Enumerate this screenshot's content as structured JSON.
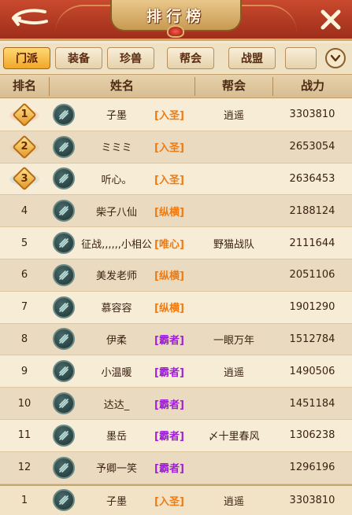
{
  "header": {
    "title": "排行榜",
    "back_icon": "back-arrow-icon",
    "close_icon": "close-icon"
  },
  "tabs": [
    {
      "label": "门派",
      "active": true
    },
    {
      "label": "装备",
      "active": false
    },
    {
      "label": "珍兽",
      "active": false
    },
    {
      "label": "帮会",
      "active": false
    },
    {
      "label": "战盟",
      "active": false
    }
  ],
  "columns": {
    "rank": "排名",
    "name": "姓名",
    "guild": "帮会",
    "power": "战力"
  },
  "rows": [
    {
      "rank": "1",
      "name": "子墨",
      "faction": "[入圣]",
      "guild": "逍遥",
      "power": "3303810"
    },
    {
      "rank": "2",
      "name": "ミミミ",
      "faction": "[入圣]",
      "guild": "",
      "power": "2653054"
    },
    {
      "rank": "3",
      "name": "听心。",
      "faction": "[入圣]",
      "guild": "",
      "power": "2636453"
    },
    {
      "rank": "4",
      "name": "柴子八仙",
      "faction": "[纵横]",
      "guild": "",
      "power": "2188124"
    },
    {
      "rank": "5",
      "name": "征战,,,,,,小相公",
      "faction": "[唯心]",
      "guild": "野猫战队",
      "power": "2111644"
    },
    {
      "rank": "6",
      "name": "美发老师",
      "faction": "[纵横]",
      "guild": "",
      "power": "2051106"
    },
    {
      "rank": "7",
      "name": "慕容容",
      "faction": "[纵横]",
      "guild": "",
      "power": "1901290"
    },
    {
      "rank": "8",
      "name": "伊柔",
      "faction": "[霸者]",
      "guild": "一眼万年",
      "power": "1512784"
    },
    {
      "rank": "9",
      "name": "小温暖",
      "faction": "[霸者]",
      "guild": "逍遥",
      "power": "1490506"
    },
    {
      "rank": "10",
      "name": "达达_",
      "faction": "[霸者]",
      "guild": "",
      "power": "1451184"
    },
    {
      "rank": "11",
      "name": "墨岳",
      "faction": "[霸者]",
      "guild": "〆十里春风",
      "power": "1306238"
    },
    {
      "rank": "12",
      "name": "予卿一笑",
      "faction": "[霸者]",
      "guild": "",
      "power": "1296196"
    }
  ],
  "my_row": {
    "rank": "1",
    "name": "子墨",
    "faction": "[入圣]",
    "guild": "逍遥",
    "power": "3303810"
  },
  "colors": {
    "faction_orange": "#f07a10",
    "faction_purple": "#a020d8",
    "header_red": "#b23a22",
    "tab_active": "#f0a72a"
  }
}
